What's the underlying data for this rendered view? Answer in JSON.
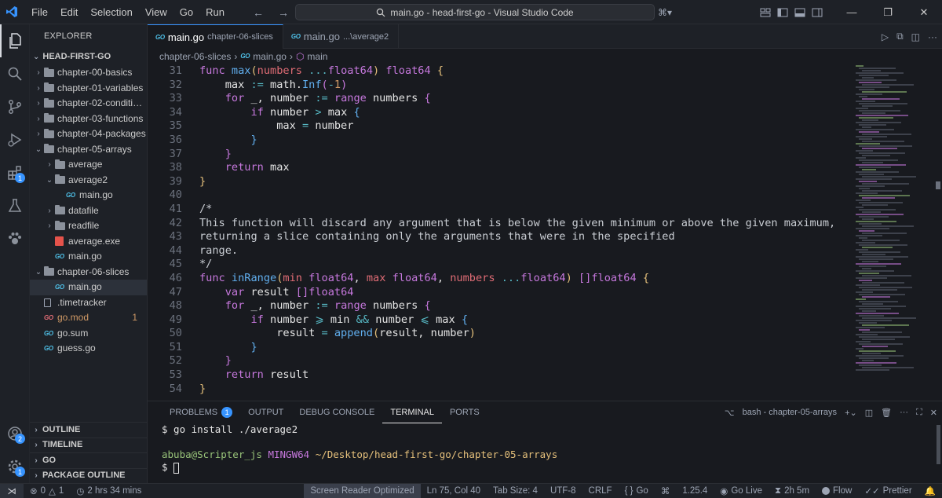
{
  "menu": [
    "File",
    "Edit",
    "Selection",
    "View",
    "Go",
    "Run"
  ],
  "search": {
    "text": "main.go - head-first-go - Visual Studio Code"
  },
  "activity": {
    "extensions_badge": "1",
    "accounts_badge": "2"
  },
  "sidebar": {
    "title": "EXPLORER",
    "root": "HEAD-FIRST-GO",
    "items": [
      {
        "label": "chapter-00-basics",
        "type": "folder",
        "expanded": false,
        "depth": 1
      },
      {
        "label": "chapter-01-variables",
        "type": "folder",
        "expanded": false,
        "depth": 1
      },
      {
        "label": "chapter-02-conditionals",
        "type": "folder",
        "expanded": false,
        "depth": 1
      },
      {
        "label": "chapter-03-functions",
        "type": "folder",
        "expanded": false,
        "depth": 1
      },
      {
        "label": "chapter-04-packages",
        "type": "folder",
        "expanded": false,
        "depth": 1
      },
      {
        "label": "chapter-05-arrays",
        "type": "folder",
        "expanded": true,
        "depth": 1
      },
      {
        "label": "average",
        "type": "folder",
        "expanded": false,
        "depth": 2
      },
      {
        "label": "average2",
        "type": "folder",
        "expanded": true,
        "depth": 2
      },
      {
        "label": "main.go",
        "type": "go",
        "depth": 3
      },
      {
        "label": "datafile",
        "type": "folder",
        "expanded": false,
        "depth": 2
      },
      {
        "label": "readfile",
        "type": "folder",
        "expanded": false,
        "depth": 2
      },
      {
        "label": "average.exe",
        "type": "exe",
        "depth": 2
      },
      {
        "label": "main.go",
        "type": "go",
        "depth": 2
      },
      {
        "label": "chapter-06-slices",
        "type": "folder",
        "expanded": true,
        "depth": 1
      },
      {
        "label": "main.go",
        "type": "go",
        "depth": 2,
        "selected": true
      },
      {
        "label": ".timetracker",
        "type": "file",
        "depth": 1
      },
      {
        "label": "go.mod",
        "type": "gomod",
        "depth": 1,
        "count": "1"
      },
      {
        "label": "go.sum",
        "type": "go",
        "depth": 1
      },
      {
        "label": "guess.go",
        "type": "go",
        "depth": 1
      }
    ],
    "sections": [
      "OUTLINE",
      "TIMELINE",
      "GO",
      "PACKAGE OUTLINE"
    ]
  },
  "tabs": [
    {
      "name": "main.go",
      "desc": "chapter-06-slices",
      "active": true
    },
    {
      "name": "main.go",
      "desc": "...\\average2",
      "active": false
    }
  ],
  "breadcrumb": {
    "folder": "chapter-06-slices",
    "file": "main.go",
    "symbol": "main"
  },
  "code": [
    {
      "n": "31",
      "t": [
        [
          "kw",
          "func "
        ],
        [
          "fn",
          "max"
        ],
        [
          "br",
          "("
        ],
        [
          "prm",
          "numbers"
        ],
        [
          "id",
          " "
        ],
        [
          "op",
          "..."
        ],
        [
          "ty",
          "float64"
        ],
        [
          "br",
          ")"
        ],
        [
          "ty",
          " float64 "
        ],
        [
          "br",
          "{"
        ]
      ]
    },
    {
      "n": "32",
      "t": [
        [
          "id",
          "    max "
        ],
        [
          "op",
          ":="
        ],
        [
          "id",
          " math."
        ],
        [
          "fn",
          "Inf"
        ],
        [
          "br2",
          "("
        ],
        [
          "op",
          "-"
        ],
        [
          "num",
          "1"
        ],
        [
          "br2",
          ")"
        ]
      ]
    },
    {
      "n": "33",
      "t": [
        [
          "kw",
          "    for "
        ],
        [
          "id",
          "_, number "
        ],
        [
          "op",
          ":="
        ],
        [
          "kw",
          " range "
        ],
        [
          "id",
          "numbers "
        ],
        [
          "br2",
          "{"
        ]
      ]
    },
    {
      "n": "34",
      "t": [
        [
          "kw",
          "        if "
        ],
        [
          "id",
          "number "
        ],
        [
          "op",
          ">"
        ],
        [
          "id",
          " max "
        ],
        [
          "br3",
          "{"
        ]
      ]
    },
    {
      "n": "35",
      "t": [
        [
          "id",
          "            max "
        ],
        [
          "op",
          "="
        ],
        [
          "id",
          " number"
        ]
      ]
    },
    {
      "n": "36",
      "t": [
        [
          "br3",
          "        }"
        ]
      ]
    },
    {
      "n": "37",
      "t": [
        [
          "br2",
          "    }"
        ]
      ]
    },
    {
      "n": "38",
      "t": [
        [
          "kw",
          "    return "
        ],
        [
          "id",
          "max"
        ]
      ]
    },
    {
      "n": "39",
      "t": [
        [
          "br",
          "}"
        ]
      ]
    },
    {
      "n": "40",
      "t": []
    },
    {
      "n": "41",
      "t": [
        [
          "cm",
          "/*"
        ]
      ]
    },
    {
      "n": "42",
      "t": [
        [
          "cm",
          "This function will discard any argument that is below the given minimum or above the given maximum,"
        ]
      ]
    },
    {
      "n": "43",
      "t": [
        [
          "cm",
          "returning a slice containing only the arguments that were in the specified"
        ]
      ]
    },
    {
      "n": "44",
      "t": [
        [
          "cm",
          "range."
        ]
      ]
    },
    {
      "n": "45",
      "t": [
        [
          "cm",
          "*/"
        ]
      ]
    },
    {
      "n": "46",
      "t": [
        [
          "kw",
          "func "
        ],
        [
          "fn",
          "inRange"
        ],
        [
          "br",
          "("
        ],
        [
          "prm",
          "min"
        ],
        [
          "ty",
          " float64"
        ],
        [
          "id",
          ", "
        ],
        [
          "prm",
          "max"
        ],
        [
          "ty",
          " float64"
        ],
        [
          "id",
          ", "
        ],
        [
          "prm",
          "numbers"
        ],
        [
          "id",
          " "
        ],
        [
          "op",
          "..."
        ],
        [
          "ty",
          "float64"
        ],
        [
          "br",
          ")"
        ],
        [
          "id",
          " "
        ],
        [
          "br2",
          "[]"
        ],
        [
          "ty",
          "float64 "
        ],
        [
          "br",
          "{"
        ]
      ]
    },
    {
      "n": "47",
      "t": [
        [
          "kw",
          "    var "
        ],
        [
          "id",
          "result "
        ],
        [
          "br2",
          "[]"
        ],
        [
          "ty",
          "float64"
        ]
      ]
    },
    {
      "n": "48",
      "t": [
        [
          "kw",
          "    for "
        ],
        [
          "id",
          "_, number "
        ],
        [
          "op",
          ":="
        ],
        [
          "kw",
          " range "
        ],
        [
          "id",
          "numbers "
        ],
        [
          "br2",
          "{"
        ]
      ]
    },
    {
      "n": "49",
      "t": [
        [
          "kw",
          "        if "
        ],
        [
          "id",
          "number "
        ],
        [
          "op",
          "⩾"
        ],
        [
          "id",
          " min "
        ],
        [
          "op",
          "&&"
        ],
        [
          "id",
          " number "
        ],
        [
          "op",
          "⩽"
        ],
        [
          "id",
          " max "
        ],
        [
          "br3",
          "{"
        ]
      ]
    },
    {
      "n": "50",
      "t": [
        [
          "id",
          "            result "
        ],
        [
          "op",
          "="
        ],
        [
          "fn",
          " append"
        ],
        [
          "br",
          "("
        ],
        [
          "id",
          "result, number"
        ],
        [
          "br",
          ")"
        ]
      ]
    },
    {
      "n": "51",
      "t": [
        [
          "br3",
          "        }"
        ]
      ]
    },
    {
      "n": "52",
      "t": [
        [
          "br2",
          "    }"
        ]
      ]
    },
    {
      "n": "53",
      "t": [
        [
          "kw",
          "    return "
        ],
        [
          "id",
          "result"
        ]
      ]
    },
    {
      "n": "54",
      "t": [
        [
          "br",
          "}"
        ]
      ]
    }
  ],
  "panel": {
    "tabs": [
      {
        "label": "PROBLEMS",
        "badge": "1"
      },
      {
        "label": "OUTPUT"
      },
      {
        "label": "DEBUG CONSOLE"
      },
      {
        "label": "TERMINAL",
        "active": true
      },
      {
        "label": "PORTS"
      }
    ],
    "terminal_name": "bash - chapter-05-arrays",
    "lines": {
      "cmd": "$ go install ./average2",
      "user": "abuba@Scripter_js",
      "sys": "MINGW64",
      "path": "~/Desktop/head-first-go/chapter-05-arrays",
      "prompt": "$ "
    }
  },
  "status": {
    "errors": "0",
    "warnings": "1",
    "time": "2 hrs 34 mins",
    "screen_reader": "Screen Reader Optimized",
    "position": "Ln 75, Col 40",
    "tab_size": "Tab Size: 4",
    "encoding": "UTF-8",
    "eol": "CRLF",
    "language": "Go",
    "go_version": "1.25.4",
    "go_live": "Go Live",
    "timer": "2h 5m",
    "flow": "Flow",
    "prettier": "Prettier"
  }
}
